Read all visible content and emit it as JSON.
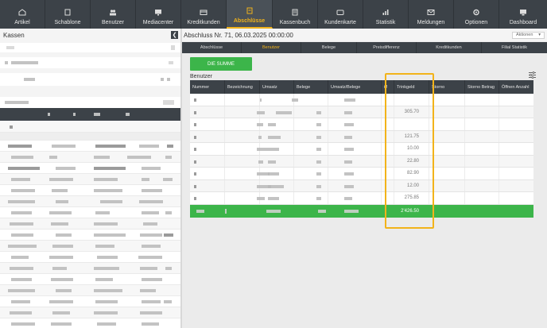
{
  "nav": {
    "items": [
      {
        "label": "Artikel",
        "icon": "artikel-icon"
      },
      {
        "label": "Schablone",
        "icon": "schablone-icon"
      },
      {
        "label": "Benutzer",
        "icon": "benutzer-icon"
      },
      {
        "label": "Mediacenter",
        "icon": "mediacenter-icon"
      },
      {
        "label": "Kreditkunden",
        "icon": "kreditkunden-icon"
      },
      {
        "label": "Abschlüsse",
        "icon": "abschluesse-icon",
        "active": true
      },
      {
        "label": "Kassenbuch",
        "icon": "kassenbuch-icon"
      },
      {
        "label": "Kundenkarte",
        "icon": "kundenkarte-icon"
      },
      {
        "label": "Statistik",
        "icon": "statistik-icon"
      },
      {
        "label": "Meldungen",
        "icon": "meldungen-icon"
      },
      {
        "label": "Optionen",
        "icon": "optionen-icon"
      },
      {
        "label": "Dashboard",
        "icon": "dashboard-icon"
      }
    ]
  },
  "left": {
    "title": "Kassen",
    "collapse_glyph": "❮"
  },
  "main": {
    "title": "Abschluss Nr. 71, 06.03.2025 00:00:00",
    "actions_label": "Aktionen",
    "tabs": [
      "Abschlüsse",
      "Benutzer",
      "Belege",
      "Preisdifferenz",
      "Kreditkunden",
      "Filial Statistik"
    ],
    "active_tab": "Benutzer",
    "summe_button": "DIE SUMME",
    "section_title": "Benutzer",
    "table": {
      "columns": [
        "Nummer",
        "Bezeichnung",
        "Umsatz",
        "Belege",
        "Umsatz/Belege",
        "Ø",
        "Trinkgeld",
        "Storno",
        "Storno Betrag",
        "Öffnen Anzahl"
      ],
      "trinkgeld": [
        "",
        "305.70",
        "",
        "121.75",
        "10.00",
        "22.80",
        "82.90",
        "12.00",
        "275.85"
      ],
      "total_trinkgeld": "2'426.50"
    }
  },
  "colors": {
    "nav_bg": "#3c4248",
    "accent": "#f2b31a",
    "green": "#3cb54a"
  }
}
